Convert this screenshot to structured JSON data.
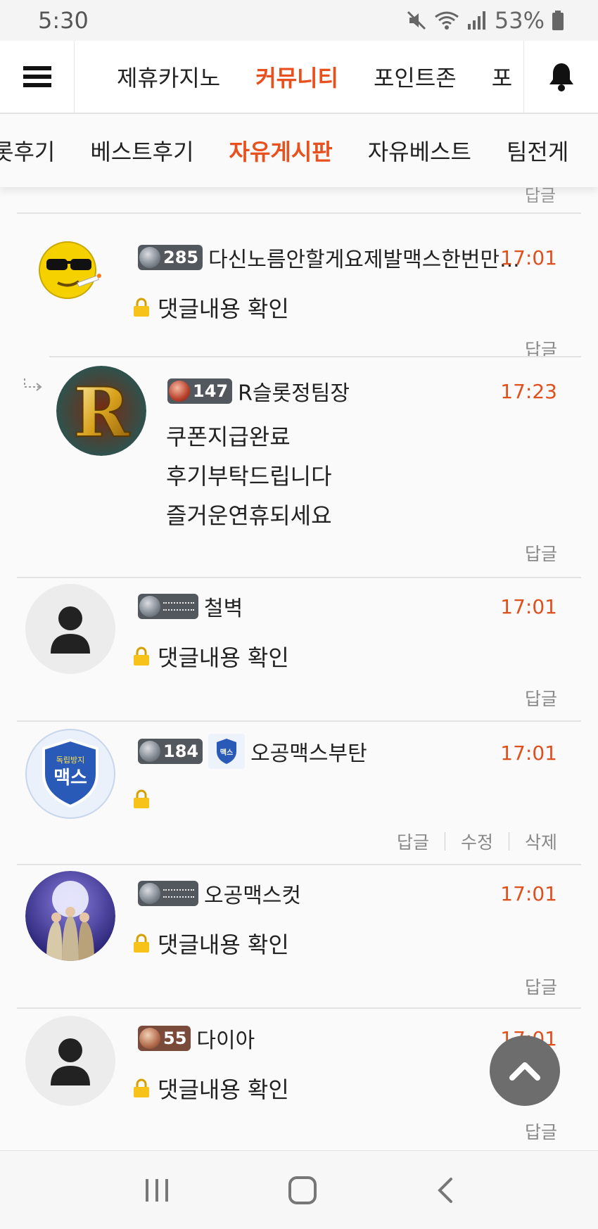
{
  "status_bar": {
    "time": "5:30",
    "battery": "53%"
  },
  "top_nav": {
    "tabs": [
      {
        "label": "제휴카지노",
        "active": false
      },
      {
        "label": "커뮤니티",
        "active": true
      },
      {
        "label": "포인트존",
        "active": false
      },
      {
        "label": "포",
        "active": false
      }
    ]
  },
  "sub_nav": {
    "tabs": [
      {
        "label": "롯후기",
        "active": false
      },
      {
        "label": "베스트후기",
        "active": false
      },
      {
        "label": "자유게시판",
        "active": true
      },
      {
        "label": "자유베스트",
        "active": false
      },
      {
        "label": "팀전게",
        "active": false
      }
    ]
  },
  "labels": {
    "reply": "답글",
    "edit": "수정",
    "delete": "삭제"
  },
  "comments": [
    {
      "level": "285",
      "user": "다신노름안할게요제발맥스한번만...",
      "time": "17:01",
      "lines": [
        "댓글내용 확인"
      ],
      "locked": true
    },
    {
      "level": "147",
      "user": "R슬롯정팀장",
      "time": "17:23",
      "lines": [
        "쿠폰지급완료",
        "후기부탁드립니다",
        "즐거운연휴되세요"
      ],
      "locked": false,
      "nested": true
    },
    {
      "level": "",
      "user": "철벽",
      "time": "17:01",
      "lines": [
        "댓글내용 확인"
      ],
      "locked": true
    },
    {
      "level": "184",
      "user": "오공맥스부탄",
      "time": "17:01",
      "lines": [],
      "locked": true,
      "own": true
    },
    {
      "level": "",
      "user": "오공맥스컷",
      "time": "17:01",
      "lines": [
        "댓글내용 확인"
      ],
      "locked": true
    },
    {
      "level": "55",
      "user": "다이아",
      "time": "17:01",
      "lines": [
        "댓글내용 확인"
      ],
      "locked": true
    }
  ],
  "avatar_text": {
    "max_badge": "맥스",
    "max_badge_top": "독립방지"
  },
  "colors": {
    "accent": "#e8501e",
    "time": "#e0501e"
  }
}
